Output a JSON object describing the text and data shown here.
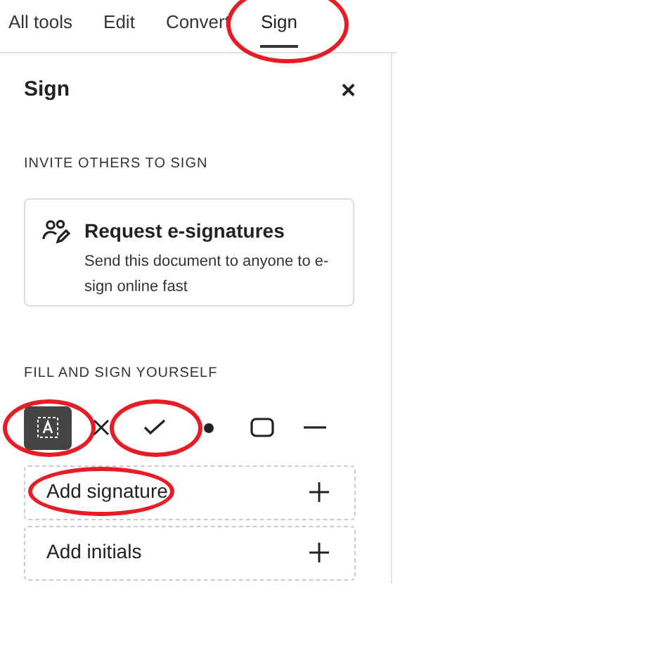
{
  "tabs": [
    {
      "label": "All tools",
      "selected": false,
      "circled": false
    },
    {
      "label": "Edit",
      "selected": false,
      "circled": false
    },
    {
      "label": "Convert",
      "selected": false,
      "circled": false
    },
    {
      "label": "Sign",
      "selected": true,
      "circled": true
    }
  ],
  "panel": {
    "title": "Sign",
    "close": "×"
  },
  "invite": {
    "heading": "INVITE OTHERS TO SIGN",
    "card": {
      "title": "Request e-signatures",
      "description": "Send this document to anyone to e-sign online fast"
    }
  },
  "fill": {
    "heading": "FILL AND SIGN YOURSELF",
    "tools": [
      {
        "kind": "text",
        "selected": true,
        "circled": true
      },
      {
        "kind": "cross",
        "selected": false,
        "circled": false
      },
      {
        "kind": "check",
        "selected": false,
        "circled": true
      },
      {
        "kind": "dot",
        "selected": false,
        "circled": false
      },
      {
        "kind": "rectangle",
        "selected": false,
        "circled": false
      },
      {
        "kind": "line",
        "selected": false,
        "circled": false
      }
    ],
    "rows": [
      {
        "label": "Add signature",
        "circled": true
      },
      {
        "label": "Add initials",
        "circled": false
      }
    ]
  }
}
